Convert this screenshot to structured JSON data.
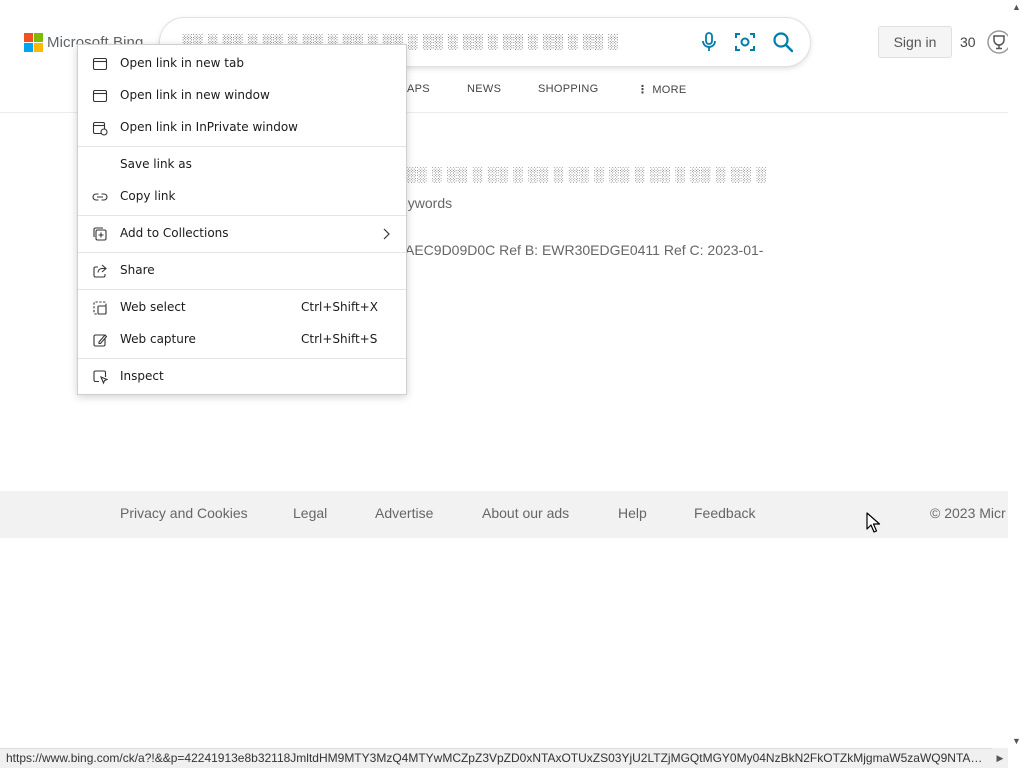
{
  "header": {
    "logo_text": "Microsoft Bing",
    "search_value": "░░ ░ ░░ ░ ░░ ░ ░░ ░ ░░ ░ ░░ ░ ░░ ░ ░░ ░ ░░ ░ ░░ ░ ░░ ░",
    "sign_in_label": "Sign in",
    "points": "30",
    "tabs": [
      {
        "label": "APS"
      },
      {
        "label": "NEWS"
      },
      {
        "label": "SHOPPING"
      },
      {
        "label": "MORE"
      }
    ]
  },
  "content": {
    "result_title": "░░ ░ ░░ ░ ░░ ░ ░░ ░ ░░ ░ ░░ ░ ░░ ░ ░░ ░ ░░ ░",
    "result_sub": "eywords",
    "ref_text": "AEC9D09D0C Ref B: EWR30EDGE0411 Ref C: 2023-01-"
  },
  "context_menu": {
    "open_new_tab": "Open link in new tab",
    "open_new_window": "Open link in new window",
    "open_inprivate": "Open link in InPrivate window",
    "save_link": "Save link as",
    "copy_link": "Copy link",
    "add_collections": "Add to Collections",
    "share": "Share",
    "web_select": "Web select",
    "web_select_shortcut": "Ctrl+Shift+X",
    "web_capture": "Web capture",
    "web_capture_shortcut": "Ctrl+Shift+S",
    "inspect": "Inspect"
  },
  "footer": {
    "links": [
      {
        "label": "Privacy and Cookies"
      },
      {
        "label": "Legal"
      },
      {
        "label": "Advertise"
      },
      {
        "label": "About our ads"
      },
      {
        "label": "Help"
      },
      {
        "label": "Feedback"
      }
    ],
    "copyright": "© 2023 Micr"
  },
  "status_bar": {
    "url": "https://www.bing.com/ck/a?!&&p=42241913e8b32118JmltdHM9MTY3MzQ4MTYwMCZpZ3VpZD0xNTAxOTUxZS03YjU2LTZjMGQtMGY0My04NzBkN2FkOTZkMjgmaW5zaWQ9NTAzNg..."
  },
  "colors": {
    "ms_red": "#f25022",
    "ms_green": "#7fba00",
    "ms_blue": "#00a4ef",
    "ms_yellow": "#ffb900",
    "bing_teal": "#007daa",
    "footer_bg": "#f2f2f2"
  },
  "icons": {
    "mic": "microphone-icon",
    "visual_search": "visual-search-icon",
    "search": "search-icon",
    "rewards": "trophy-icon"
  }
}
